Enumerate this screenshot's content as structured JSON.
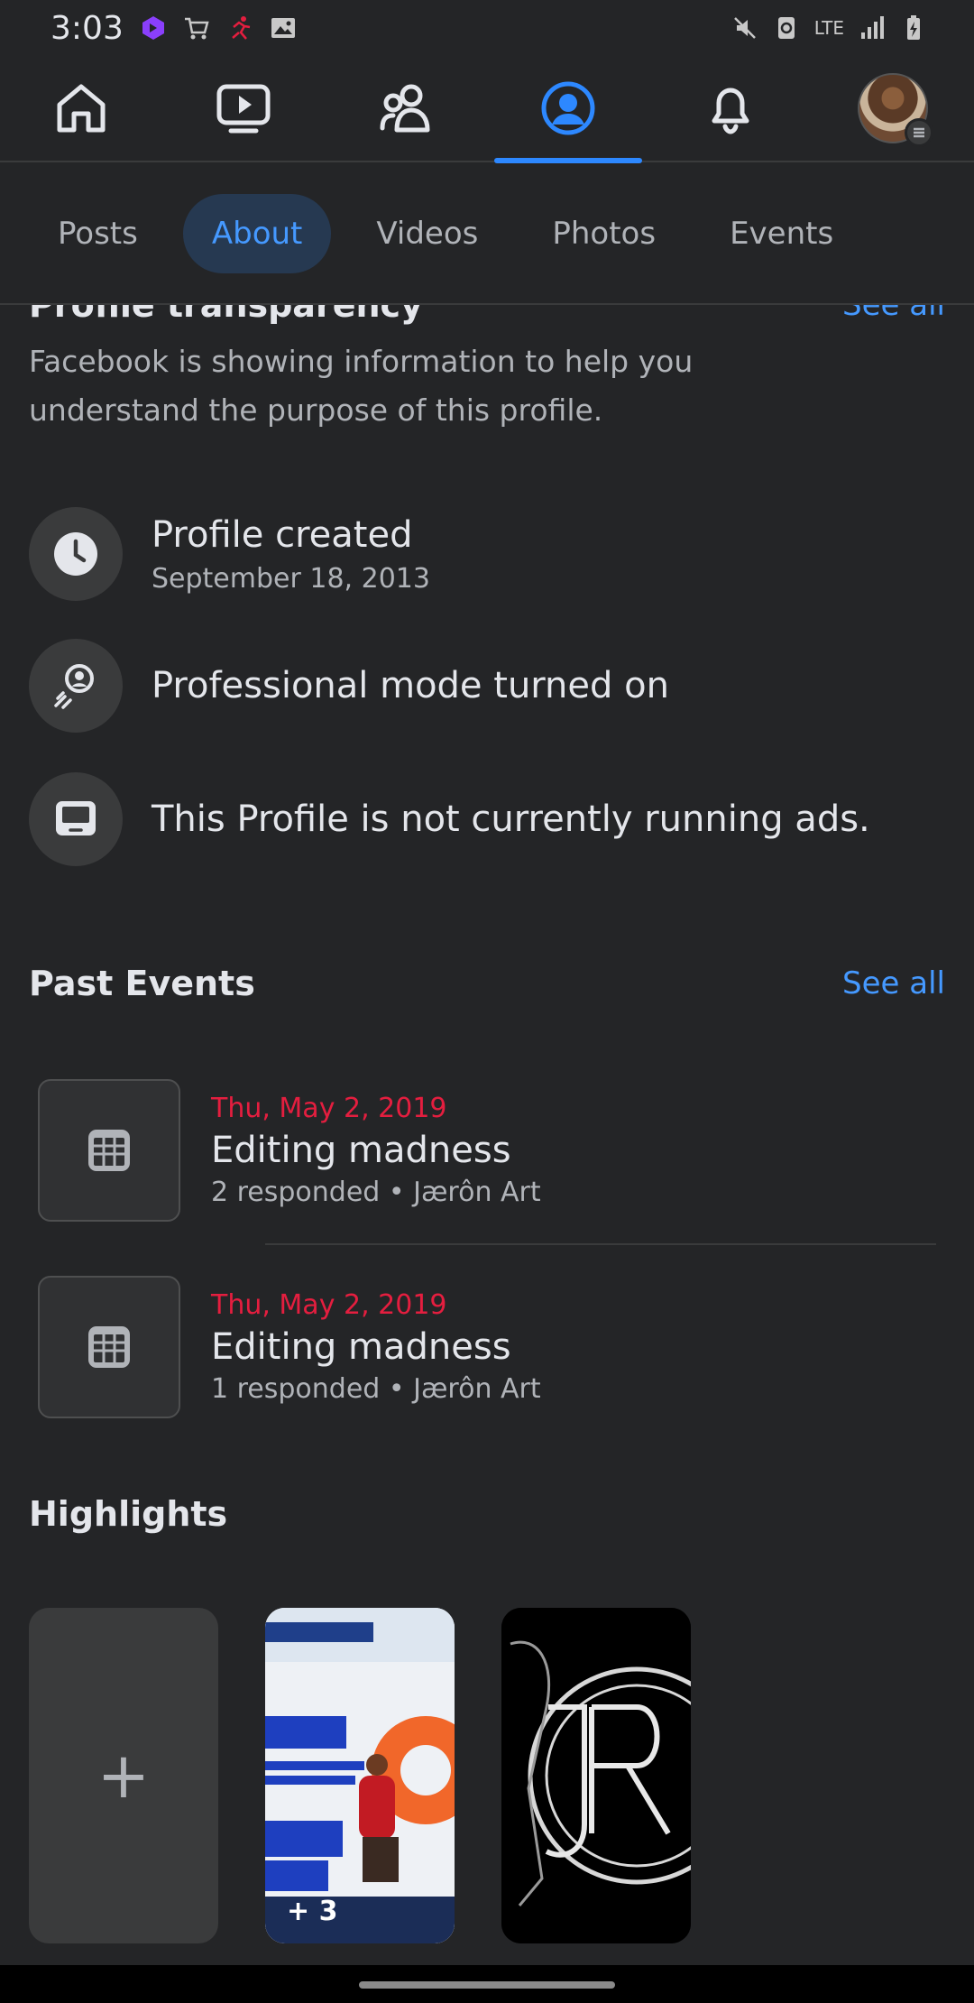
{
  "status_bar": {
    "time": "3:03",
    "network": "LTE",
    "icons": [
      "notification-app-icon",
      "cart-icon",
      "running-icon",
      "image-icon",
      "mute-icon",
      "recycle-icon",
      "signal-icon",
      "battery-icon"
    ]
  },
  "top_nav": {
    "items": [
      {
        "name": "home",
        "icon": "home-icon"
      },
      {
        "name": "video",
        "icon": "video-icon"
      },
      {
        "name": "friends",
        "icon": "friends-icon"
      },
      {
        "name": "profile",
        "icon": "profile-icon",
        "active": true
      },
      {
        "name": "notifications",
        "icon": "bell-icon"
      },
      {
        "name": "menu",
        "icon": "avatar"
      }
    ],
    "accent_color": "#2d88ff"
  },
  "tabs": [
    {
      "label": "Posts"
    },
    {
      "label": "About",
      "active": true
    },
    {
      "label": "Videos"
    },
    {
      "label": "Photos"
    },
    {
      "label": "Events"
    }
  ],
  "transparency": {
    "title": "Profile transparency",
    "see_all": "See all",
    "description": "Facebook is showing information to help you understand the purpose of this profile.",
    "items": [
      {
        "main": "Profile created",
        "sub": "September 18, 2013",
        "icon": "clock-icon"
      },
      {
        "main": "Professional mode turned on",
        "icon": "professional-mode-icon"
      },
      {
        "main": "This Profile is not currently running ads.",
        "icon": "ads-monitor-icon"
      }
    ]
  },
  "past_events": {
    "title": "Past Events",
    "see_all": "See all",
    "events": [
      {
        "date": "Thu, May 2, 2019",
        "title": "Editing madness",
        "meta": "2 responded • Jærôn Art"
      },
      {
        "date": "Thu, May 2, 2019",
        "title": "Editing madness",
        "meta": "1 responded • Jærôn Art"
      }
    ]
  },
  "highlights": {
    "title": "Highlights",
    "cards": [
      {
        "type": "new",
        "plus": "+"
      },
      {
        "type": "collection",
        "count": "+ 3"
      },
      {
        "type": "featured"
      }
    ]
  }
}
